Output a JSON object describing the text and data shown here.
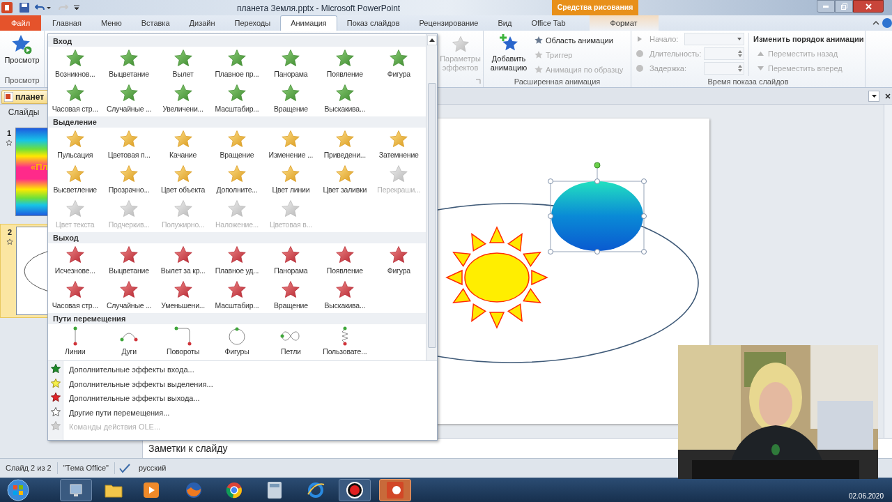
{
  "title_bar": {
    "title": "планета Земля.pptx - Microsoft PowerPoint",
    "context_header": "Средства рисования"
  },
  "tabs": [
    {
      "label": "Файл",
      "kind": "file",
      "selected": false
    },
    {
      "label": "Главная",
      "kind": "normal",
      "selected": false
    },
    {
      "label": "Меню",
      "kind": "normal",
      "selected": false
    },
    {
      "label": "Вставка",
      "kind": "normal",
      "selected": false
    },
    {
      "label": "Дизайн",
      "kind": "normal",
      "selected": false
    },
    {
      "label": "Переходы",
      "kind": "normal",
      "selected": false
    },
    {
      "label": "Анимация",
      "kind": "normal",
      "selected": true
    },
    {
      "label": "Показ слайдов",
      "kind": "normal",
      "selected": false
    },
    {
      "label": "Рецензирование",
      "kind": "normal",
      "selected": false
    },
    {
      "label": "Вид",
      "kind": "normal",
      "selected": false
    },
    {
      "label": "Office Tab",
      "kind": "normal",
      "selected": false
    },
    {
      "label": "Формат",
      "kind": "context",
      "selected": false
    }
  ],
  "ribbon": {
    "preview": {
      "button": "Просмотр",
      "group": "Просмотр"
    },
    "effect_options": {
      "label": "Параметры эффектов",
      "disabled": true
    },
    "advanced": {
      "add_button": "Добавить анимацию",
      "group": "Расширенная анимация",
      "items": [
        {
          "label": "Область анимации",
          "disabled": false
        },
        {
          "label": "Триггер",
          "disabled": true
        },
        {
          "label": "Анимация по образцу",
          "disabled": true
        }
      ]
    },
    "timing": {
      "group": "Время показа слайдов",
      "fields": [
        {
          "label": "Начало:",
          "kind": "dropdown",
          "disabled": true
        },
        {
          "label": "Длительность:",
          "kind": "spinner",
          "disabled": true
        },
        {
          "label": "Задержка:",
          "kind": "spinner",
          "disabled": true
        }
      ],
      "reorder_title": "Изменить порядок анимации",
      "reorder": [
        {
          "label": "Переместить назад",
          "kind": "up",
          "disabled": true
        },
        {
          "label": "Переместить вперед",
          "kind": "down",
          "disabled": true
        }
      ]
    }
  },
  "gallery": {
    "sections": [
      {
        "title": "Вход",
        "kind": "entrance",
        "items": [
          {
            "label": "Возникнов...",
            "disabled": false
          },
          {
            "label": "Выцветание",
            "disabled": false
          },
          {
            "label": "Вылет",
            "disabled": false
          },
          {
            "label": "Плавное пр...",
            "disabled": false
          },
          {
            "label": "Панорама",
            "disabled": false
          },
          {
            "label": "Появление",
            "disabled": false
          },
          {
            "label": "Фигура",
            "disabled": false
          },
          {
            "label": "Часовая стр...",
            "disabled": false
          },
          {
            "label": "Случайные ...",
            "disabled": false
          },
          {
            "label": "Увеличени...",
            "disabled": false
          },
          {
            "label": "Масштабир...",
            "disabled": false
          },
          {
            "label": "Вращение",
            "disabled": false
          },
          {
            "label": "Выскакива...",
            "disabled": false
          }
        ]
      },
      {
        "title": "Выделение",
        "kind": "emphasis",
        "items": [
          {
            "label": "Пульсация",
            "disabled": false
          },
          {
            "label": "Цветовая п...",
            "disabled": false
          },
          {
            "label": "Качание",
            "disabled": false
          },
          {
            "label": "Вращение",
            "disabled": false
          },
          {
            "label": "Изменение ...",
            "disabled": false
          },
          {
            "label": "Приведени...",
            "disabled": false
          },
          {
            "label": "Затемнение",
            "disabled": false
          },
          {
            "label": "Высветление",
            "disabled": false
          },
          {
            "label": "Прозрачно...",
            "disabled": false
          },
          {
            "label": "Цвет объекта",
            "disabled": false
          },
          {
            "label": "Дополните...",
            "disabled": false
          },
          {
            "label": "Цвет линии",
            "disabled": false
          },
          {
            "label": "Цвет заливки",
            "disabled": false
          },
          {
            "label": "Перекраши...",
            "disabled": true
          },
          {
            "label": "Цвет текста",
            "disabled": true
          },
          {
            "label": "Подчеркив...",
            "disabled": true
          },
          {
            "label": "Полужирно...",
            "disabled": true
          },
          {
            "label": "Наложение...",
            "disabled": true
          },
          {
            "label": "Цветовая в...",
            "disabled": true
          }
        ]
      },
      {
        "title": "Выход",
        "kind": "exit",
        "items": [
          {
            "label": "Исчезнове...",
            "disabled": false
          },
          {
            "label": "Выцветание",
            "disabled": false
          },
          {
            "label": "Вылет за кр...",
            "disabled": false
          },
          {
            "label": "Плавное уд...",
            "disabled": false
          },
          {
            "label": "Панорама",
            "disabled": false
          },
          {
            "label": "Появление",
            "disabled": false
          },
          {
            "label": "Фигура",
            "disabled": false
          },
          {
            "label": "Часовая стр...",
            "disabled": false
          },
          {
            "label": "Случайные ...",
            "disabled": false
          },
          {
            "label": "Уменьшени...",
            "disabled": false
          },
          {
            "label": "Масштабир...",
            "disabled": false
          },
          {
            "label": "Вращение",
            "disabled": false
          },
          {
            "label": "Выскакива...",
            "disabled": false
          }
        ]
      },
      {
        "title": "Пути перемещения",
        "kind": "path",
        "items": [
          {
            "label": "Линии",
            "kind": "line",
            "disabled": false
          },
          {
            "label": "Дуги",
            "kind": "arc",
            "disabled": false
          },
          {
            "label": "Повороты",
            "kind": "turn",
            "disabled": false
          },
          {
            "label": "Фигуры",
            "kind": "circle",
            "disabled": false
          },
          {
            "label": "Петли",
            "kind": "loop",
            "disabled": false
          },
          {
            "label": "Пользовате...",
            "kind": "custom",
            "disabled": false
          }
        ]
      }
    ],
    "menu": [
      {
        "label": "Дополнительные эффекты входа...",
        "kind": "entrance",
        "disabled": false
      },
      {
        "label": "Дополнительные эффекты выделения...",
        "kind": "emphasis",
        "disabled": false
      },
      {
        "label": "Дополнительные эффекты выхода...",
        "kind": "exit",
        "disabled": false
      },
      {
        "label": "Другие пути перемещения...",
        "kind": "path",
        "disabled": false
      },
      {
        "label": "Команды действия OLE...",
        "kind": "ole",
        "disabled": true
      }
    ]
  },
  "document_tab": "планет",
  "slides_panel": {
    "title": "Слайды",
    "slides": [
      {
        "number": "1",
        "title_text": "«Пл",
        "selected": false
      },
      {
        "number": "2",
        "selected": true
      }
    ]
  },
  "notes": {
    "placeholder": "Заметки к слайду"
  },
  "status_bar": {
    "slide": "Слайд 2 из 2",
    "theme": "\"Тема Office\"",
    "language": "русский"
  },
  "taskbar": {
    "date": "02.06.2020"
  }
}
